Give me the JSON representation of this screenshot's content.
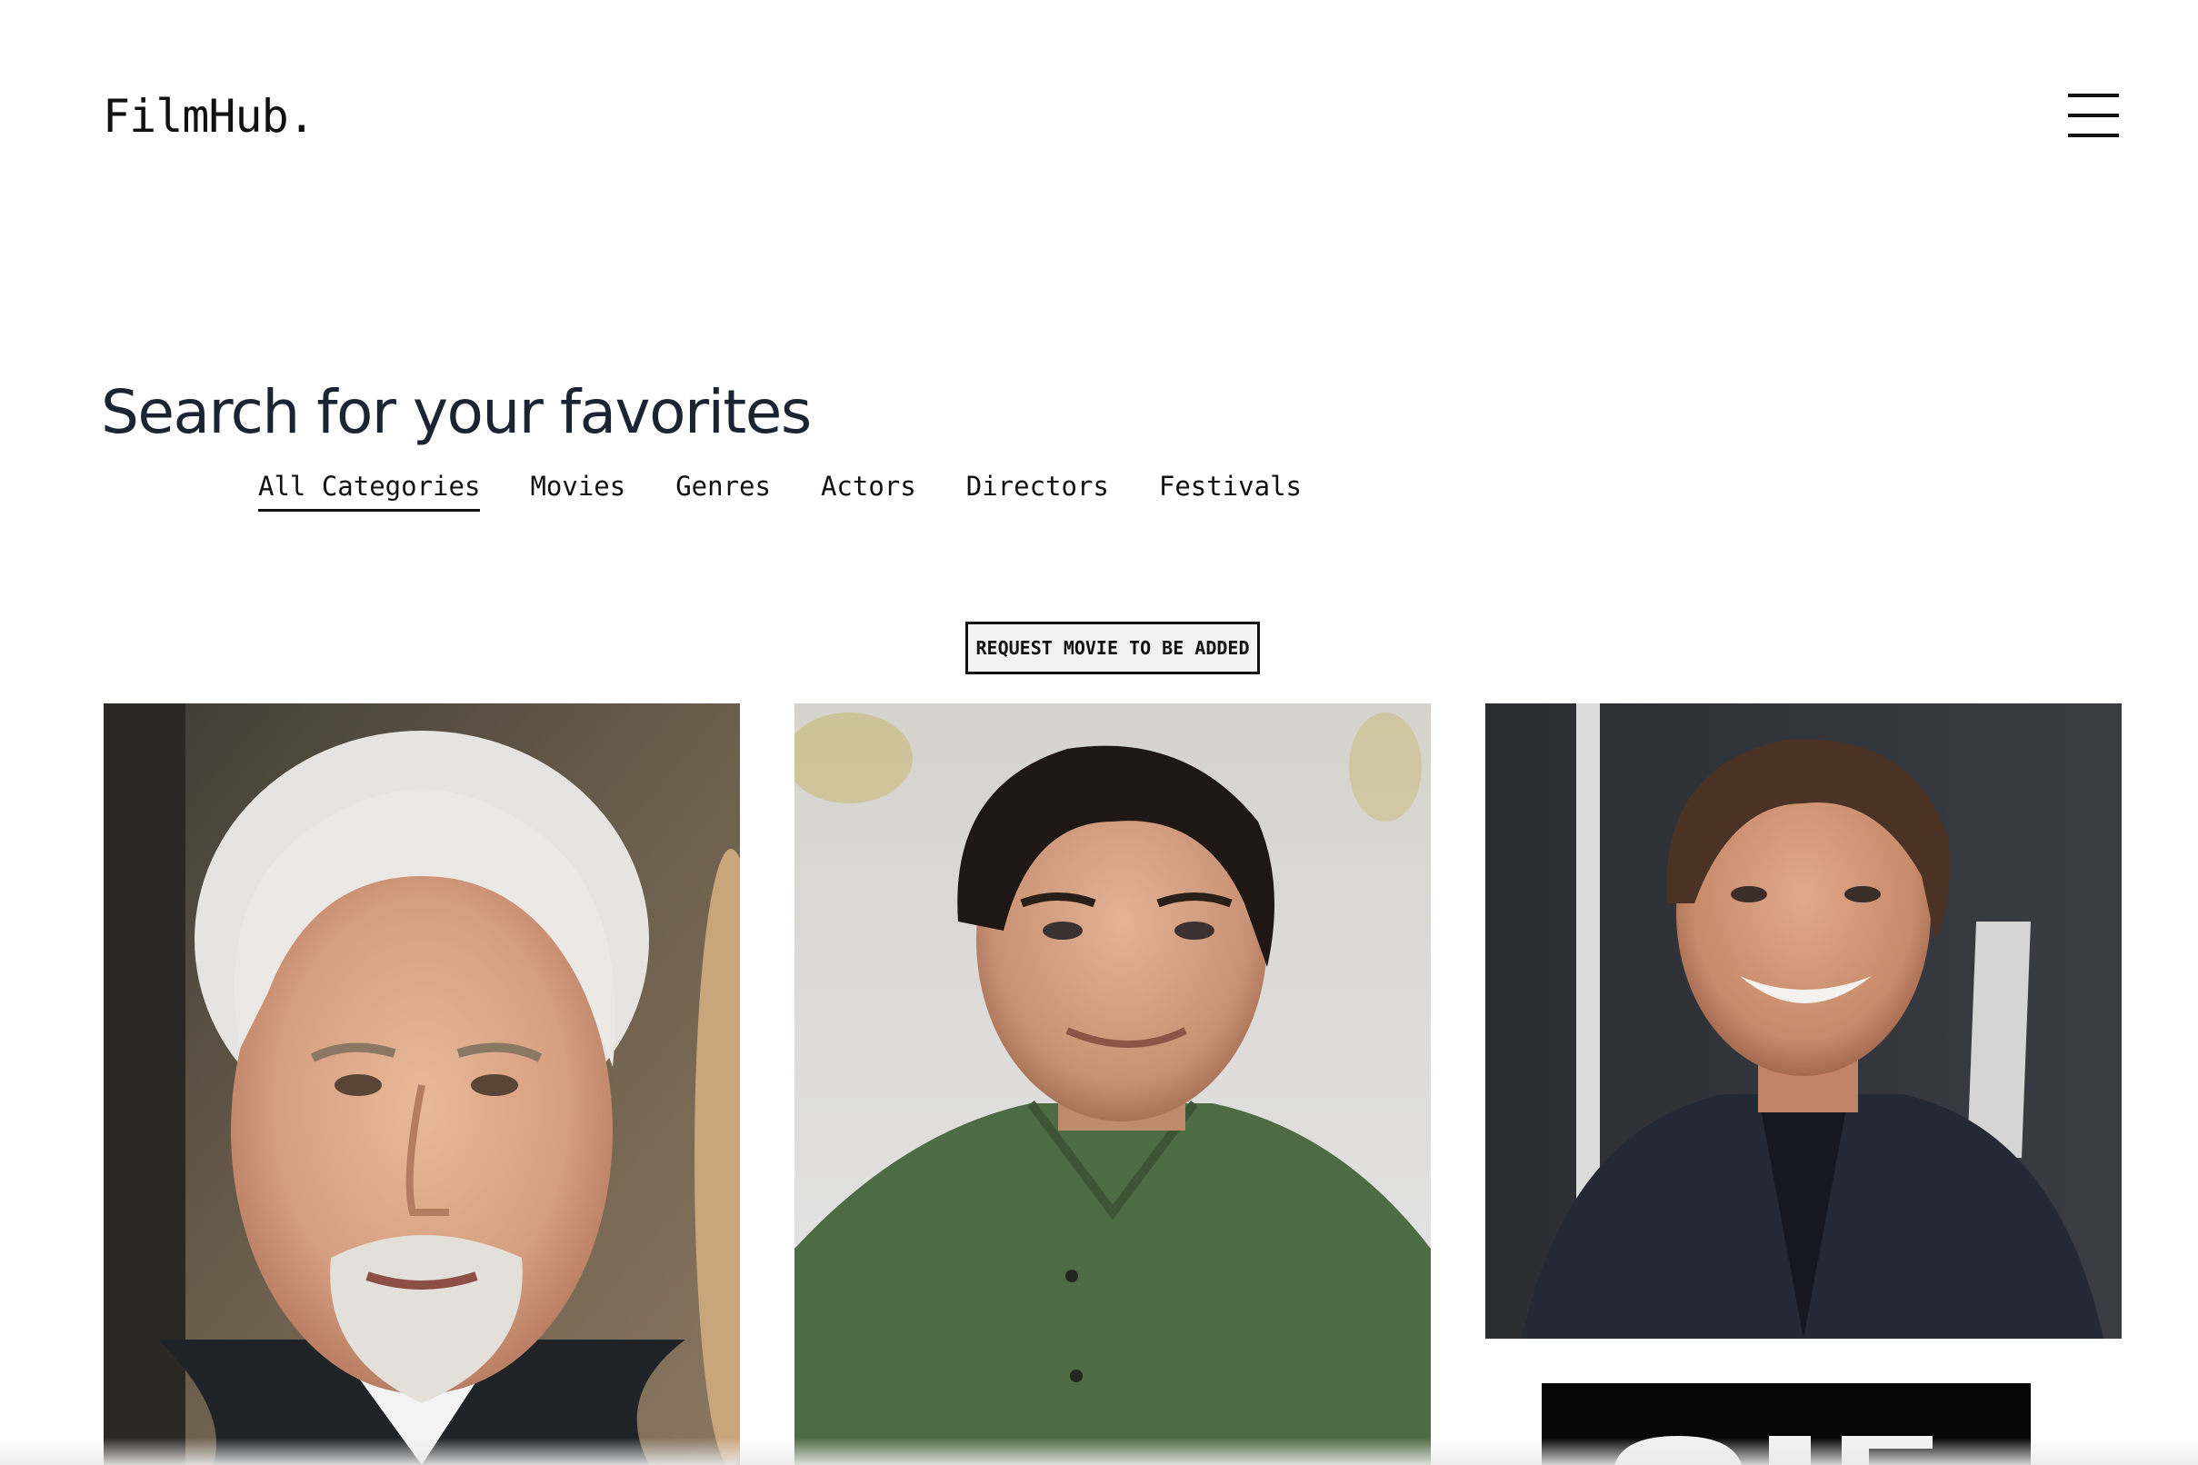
{
  "header": {
    "logo": "FilmHub.",
    "menu_icon": "hamburger-menu-icon"
  },
  "hero": {
    "title": "Search for your favorites"
  },
  "tabs": [
    {
      "label": "All Categories",
      "active": true
    },
    {
      "label": "Movies",
      "active": false
    },
    {
      "label": "Genres",
      "active": false
    },
    {
      "label": "Actors",
      "active": false
    },
    {
      "label": "Directors",
      "active": false
    },
    {
      "label": "Festivals",
      "active": false
    }
  ],
  "request_button": {
    "label": "REQUEST MOVIE TO BE ADDED"
  },
  "cards": [
    {
      "image": "portrait-photo-white-haired-man-goatee"
    },
    {
      "image": "portrait-photo-dark-haired-man-green-shirt"
    },
    {
      "image": "portrait-photo-smiling-man-dark-suit"
    },
    {
      "image": "dark-poster-image-partial"
    }
  ],
  "colors": {
    "text": "#111111",
    "title": "#1b2433",
    "background": "#ffffff",
    "button_bg": "#f2f2f2"
  }
}
